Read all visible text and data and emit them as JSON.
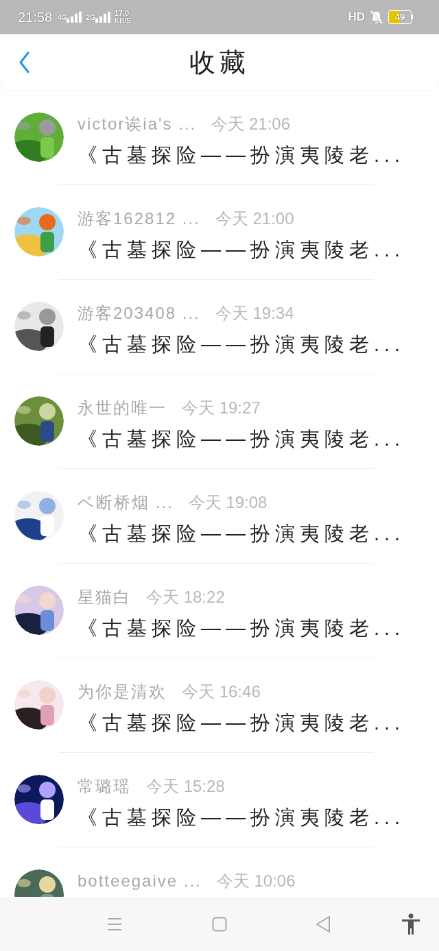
{
  "status_bar": {
    "time": "21:58",
    "network_1": "4G",
    "network_2": "2G",
    "speed": "17.0",
    "speed_unit": "KB/S",
    "hd": "HD",
    "battery": "49"
  },
  "header": {
    "title": "收藏"
  },
  "items": [
    {
      "name": "victor诶ia's ...",
      "time": "今天 21:06",
      "title": "《古墓探险——扮演夷陵老..."
    },
    {
      "name": "游客162812 ...",
      "time": "今天 21:00",
      "title": "《古墓探险——扮演夷陵老..."
    },
    {
      "name": "游客203408 ...",
      "time": "今天 19:34",
      "title": "《古墓探险——扮演夷陵老..."
    },
    {
      "name": "永世的唯一",
      "time": "今天 19:27",
      "title": "《古墓探险——扮演夷陵老..."
    },
    {
      "name": "ベ断桥烟 ...",
      "time": "今天 19:08",
      "title": "《古墓探险——扮演夷陵老..."
    },
    {
      "name": "星猫白",
      "time": "今天 18:22",
      "title": "《古墓探险——扮演夷陵老..."
    },
    {
      "name": "为你是清欢",
      "time": "今天 16:46",
      "title": "《古墓探险——扮演夷陵老..."
    },
    {
      "name": "常璐瑶",
      "time": "今天 15:28",
      "title": "《古墓探险——扮演夷陵老..."
    },
    {
      "name": "botteegaive ...",
      "time": "今天 10:06"
    }
  ]
}
